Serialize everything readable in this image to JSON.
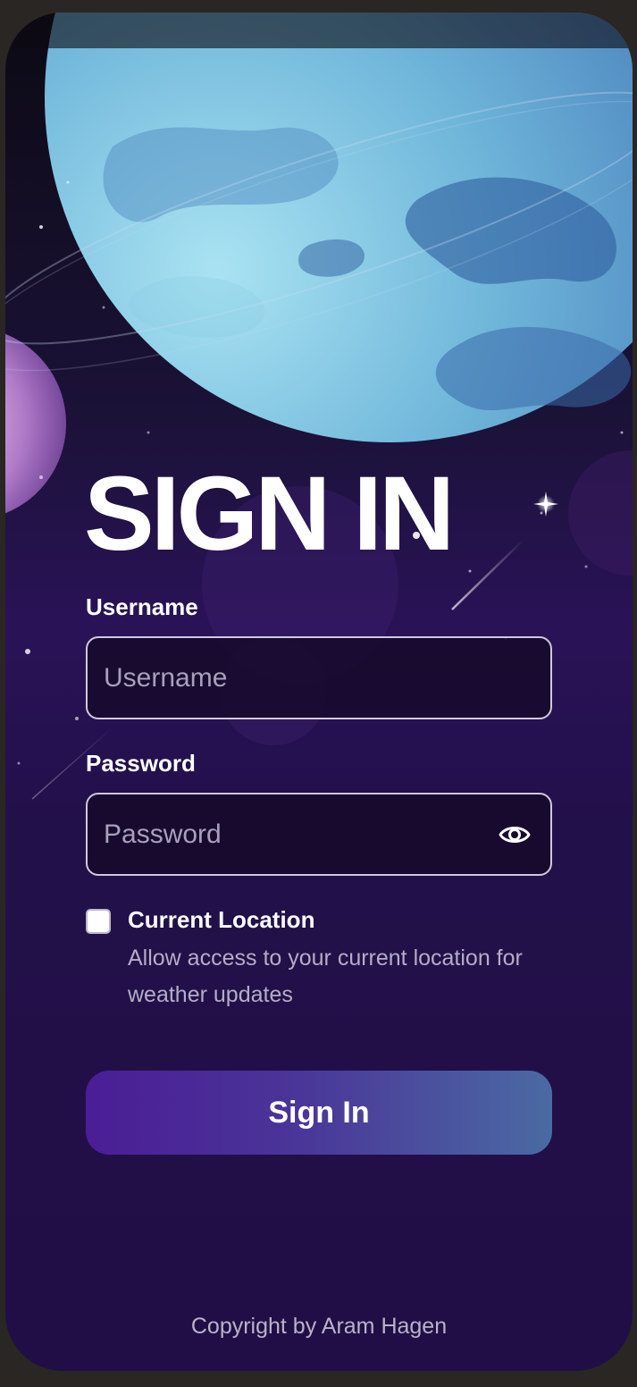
{
  "screen": {
    "title": "SIGN IN"
  },
  "username": {
    "label": "Username",
    "placeholder": "Username",
    "value": ""
  },
  "password": {
    "label": "Password",
    "placeholder": "Password",
    "value": "",
    "toggle_icon": "eye-icon"
  },
  "location": {
    "checked": false,
    "title": "Current Location",
    "description": "Allow access to your current location for weather updates"
  },
  "submit": {
    "label": "Sign In"
  },
  "footer": {
    "copyright": "Copyright by Aram Hagen"
  },
  "colors": {
    "background_top": "#0c0a14",
    "background_bottom": "#210e46",
    "planet": "#7fc3e0",
    "button_start": "#4b1d96",
    "button_end": "#4a6aa3"
  }
}
